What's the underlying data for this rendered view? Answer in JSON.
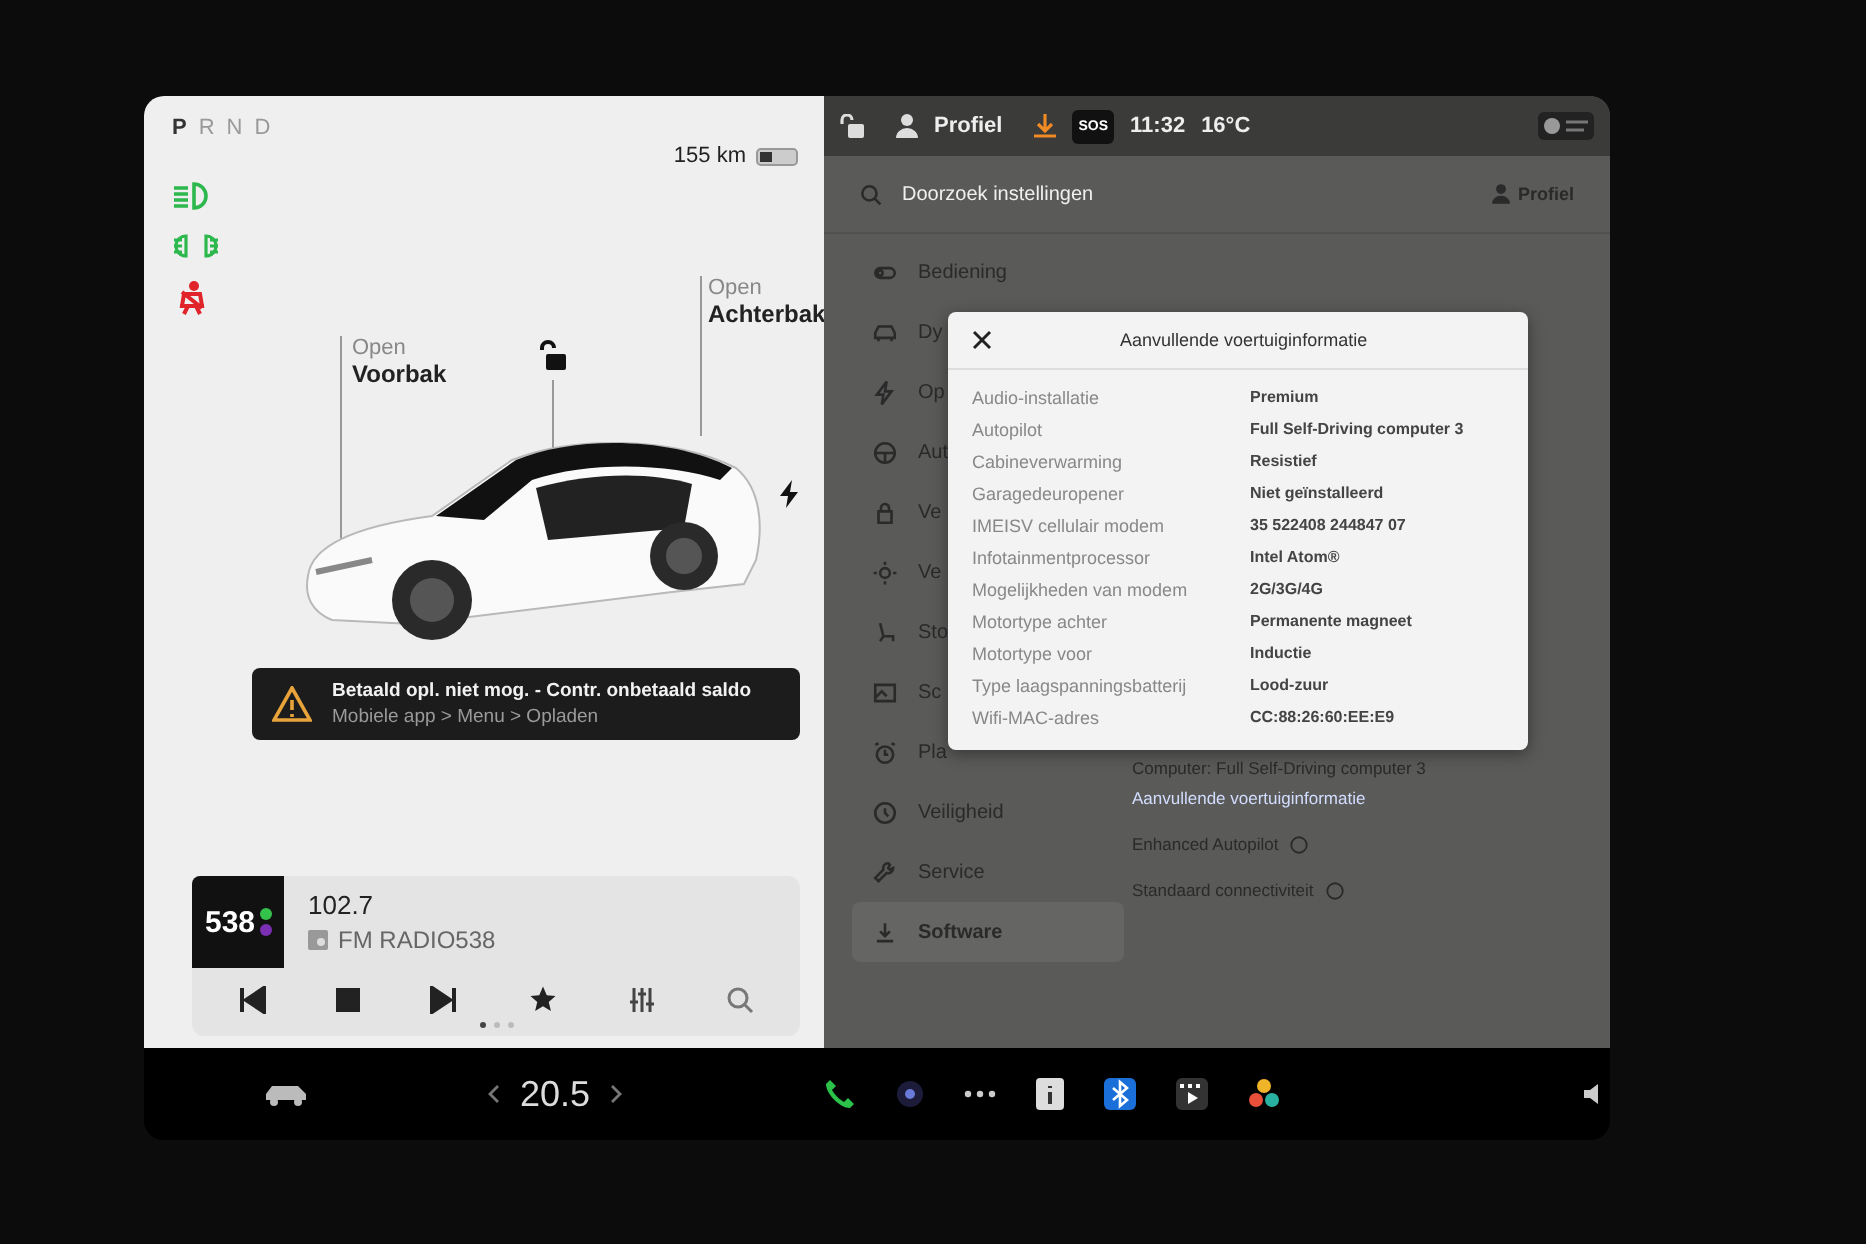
{
  "left_panel": {
    "gears": [
      {
        "label": "P",
        "selected": true
      },
      {
        "label": "R",
        "selected": false
      },
      {
        "label": "N",
        "selected": false
      },
      {
        "label": "D",
        "selected": false
      }
    ],
    "range": "155 km",
    "front_trunk": {
      "action": "Open",
      "label": "Voorbak"
    },
    "rear_trunk": {
      "action": "Open",
      "label": "Achterbak"
    },
    "alert": {
      "title": "Betaald opl. niet mog. - Contr. onbetaald saldo",
      "subtitle": "Mobiele app > Menu > Opladen"
    },
    "media": {
      "logo": "538",
      "frequency": "102.7",
      "station": "FM RADIO538",
      "pages": [
        {
          "selected": true
        },
        {
          "selected": false
        },
        {
          "selected": false
        }
      ]
    }
  },
  "top_bar": {
    "profile": "Profiel",
    "sos": "SOS",
    "time": "11:32",
    "temperature": "16°C"
  },
  "settings": {
    "search": {
      "placeholder": "Doorzoek instellingen"
    },
    "profile": "Profiel",
    "menu": [
      {
        "label": "Bediening",
        "selected": false
      },
      {
        "label": "Dy",
        "selected": false
      },
      {
        "label": "Op",
        "selected": false
      },
      {
        "label": "Aut",
        "selected": false
      },
      {
        "label": "Ve",
        "selected": false
      },
      {
        "label": "Ve",
        "selected": false
      },
      {
        "label": "Sto",
        "selected": false
      },
      {
        "label": "Sc",
        "selected": false
      },
      {
        "label": "Pla",
        "selected": false
      },
      {
        "label": "Veiligheid",
        "selected": false
      },
      {
        "label": "Service",
        "selected": false
      },
      {
        "label": "Software",
        "selected": true
      }
    ],
    "content": {
      "computer": "Computer: Full Self-Driving computer 3",
      "link": "Aanvullende voertuiginformatie",
      "feature_1": "Enhanced Autopilot",
      "feature_2": "Standaard connectiviteit"
    }
  },
  "dialog": {
    "title": "Aanvullende voertuiginformatie",
    "rows": [
      {
        "label": "Audio-installatie",
        "value": "Premium"
      },
      {
        "label": "Autopilot",
        "value": "Full Self-Driving computer 3"
      },
      {
        "label": "Cabineverwarming",
        "value": "Resistief"
      },
      {
        "label": "Garagedeuropener",
        "value": "Niet geïnstalleerd"
      },
      {
        "label": "IMEISV cellulair modem",
        "value": "35 522408 244847 07"
      },
      {
        "label": "Infotainmentprocessor",
        "value": "Intel Atom®"
      },
      {
        "label": "Mogelijkheden van modem",
        "value": "2G/3G/4G"
      },
      {
        "label": "Motortype achter",
        "value": "Permanente magneet"
      },
      {
        "label": "Motortype voor",
        "value": "Inductie"
      },
      {
        "label": "Type laagspanningsbatterij",
        "value": "Lood-zuur"
      },
      {
        "label": "Wifi-MAC-adres",
        "value": "CC:88:26:60:EE:E9"
      }
    ]
  },
  "bottom_bar": {
    "temperature": "20.5"
  }
}
